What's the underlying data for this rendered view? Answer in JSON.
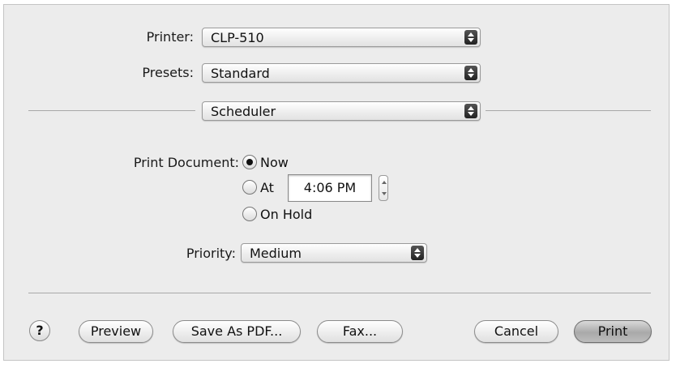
{
  "printer": {
    "label": "Printer:",
    "value": "CLP-510"
  },
  "presets": {
    "label": "Presets:",
    "value": "Standard"
  },
  "panel": {
    "value": "Scheduler"
  },
  "print_document": {
    "label": "Print Document:",
    "options": [
      {
        "label": "Now",
        "checked": true
      },
      {
        "label": "At",
        "checked": false
      },
      {
        "label": "On Hold",
        "checked": false
      }
    ],
    "time": "4:06 PM"
  },
  "priority": {
    "label": "Priority:",
    "value": "Medium"
  },
  "buttons": {
    "help": "?",
    "preview": "Preview",
    "save_pdf": "Save As PDF...",
    "fax": "Fax...",
    "cancel": "Cancel",
    "print": "Print"
  },
  "icons": {
    "popup_arrows": "updown-arrows-icon",
    "stepper": "stepper-icon",
    "help": "help-icon"
  }
}
